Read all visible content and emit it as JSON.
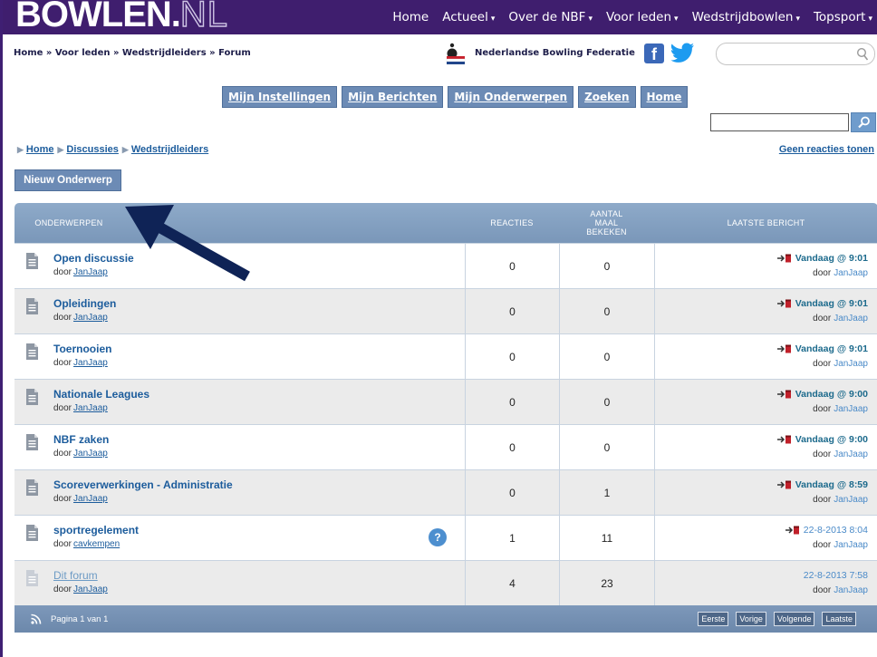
{
  "header": {
    "logo_main": "BOWLEN",
    "logo_dot": ".",
    "logo_tld": "NL",
    "nav": [
      {
        "label": "Home",
        "dropdown": false
      },
      {
        "label": "Actueel",
        "dropdown": true
      },
      {
        "label": "Over de NBF",
        "dropdown": true
      },
      {
        "label": "Voor leden",
        "dropdown": true
      },
      {
        "label": "Wedstrijdbowlen",
        "dropdown": true
      },
      {
        "label": "Topsport",
        "dropdown": true
      }
    ],
    "caret": "▾"
  },
  "subheader": {
    "breadcrumb": "Home » Voor leden » Wedstrijdleiders » Forum",
    "federation_name": "Nederlandse Bowling Federatie",
    "facebook_glyph": "f",
    "search_placeholder": ""
  },
  "forum_nav": [
    "Mijn Instellingen",
    "Mijn Berichten",
    "Mijn Onderwerpen",
    "Zoeken",
    "Home"
  ],
  "forum_search": {
    "placeholder": ""
  },
  "breadcrumb2": {
    "items": [
      "Home",
      "Discussies",
      "Wedstrijdleiders"
    ],
    "separator": "▶"
  },
  "no_replies_link": "Geen reacties tonen",
  "new_topic_button": "Nieuw Onderwerp",
  "table": {
    "headers": {
      "topics": "ONDERWERPEN",
      "replies": "REACTIES",
      "views": "AANTAL MAAL BEKEKEN",
      "last": "LAATSTE BERICHT"
    },
    "by_prefix": "door",
    "rows": [
      {
        "title": "Open discussie",
        "author": "JanJaap",
        "replies": "0",
        "views": "0",
        "last_when": "Vandaag @ 9:01",
        "last_by": "JanJaap",
        "bold": true,
        "has_goto": true,
        "has_help": false,
        "faded": false
      },
      {
        "title": "Opleidingen",
        "author": "JanJaap",
        "replies": "0",
        "views": "0",
        "last_when": "Vandaag @ 9:01",
        "last_by": "JanJaap",
        "bold": true,
        "has_goto": true,
        "has_help": false,
        "faded": false
      },
      {
        "title": "Toernooien",
        "author": "JanJaap",
        "replies": "0",
        "views": "0",
        "last_when": "Vandaag @ 9:01",
        "last_by": "JanJaap",
        "bold": true,
        "has_goto": true,
        "has_help": false,
        "faded": false
      },
      {
        "title": "Nationale Leagues",
        "author": "JanJaap",
        "replies": "0",
        "views": "0",
        "last_when": "Vandaag @ 9:00",
        "last_by": "JanJaap",
        "bold": true,
        "has_goto": true,
        "has_help": false,
        "faded": false
      },
      {
        "title": "NBF zaken",
        "author": "JanJaap",
        "replies": "0",
        "views": "0",
        "last_when": "Vandaag @ 9:00",
        "last_by": "JanJaap",
        "bold": true,
        "has_goto": true,
        "has_help": false,
        "faded": false
      },
      {
        "title": "Scoreverwerkingen - Administratie",
        "author": "JanJaap",
        "replies": "0",
        "views": "1",
        "last_when": "Vandaag @ 8:59",
        "last_by": "JanJaap",
        "bold": true,
        "has_goto": true,
        "has_help": false,
        "faded": false
      },
      {
        "title": "sportregelement",
        "author": "cavkempen",
        "replies": "1",
        "views": "11",
        "last_when": "22-8-2013 8:04",
        "last_by": "JanJaap",
        "bold": true,
        "has_goto": true,
        "has_help": true,
        "faded": false
      },
      {
        "title": "Dit forum",
        "author": "JanJaap",
        "replies": "4",
        "views": "23",
        "last_when": "22-8-2013 7:58",
        "last_by": "JanJaap",
        "bold": false,
        "has_goto": false,
        "has_help": false,
        "faded": true
      }
    ],
    "help_glyph": "?",
    "footer": {
      "page_info": "Pagina 1 van 1",
      "pager": [
        "Eerste",
        "Vorige",
        "Volgende",
        "Laatste"
      ]
    }
  },
  "colors": {
    "brand_purple": "#3f1e6e",
    "button_blue": "#6c8bb5",
    "link_blue": "#1c5c9c",
    "arrow_navy": "#0f2356"
  }
}
